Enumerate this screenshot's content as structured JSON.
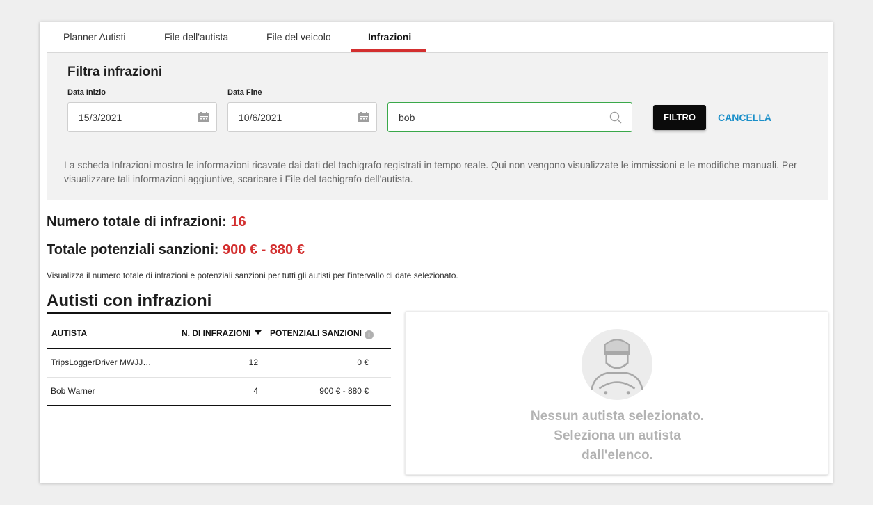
{
  "tabs": [
    {
      "label": "Planner Autisti"
    },
    {
      "label": "File dell'autista"
    },
    {
      "label": "File del veicolo"
    },
    {
      "label": "Infrazioni",
      "active": true
    }
  ],
  "filter": {
    "title": "Filtra infrazioni",
    "start_label": "Data Inizio",
    "start_value": "15/3/2021",
    "end_label": "Data Fine",
    "end_value": "10/6/2021",
    "search_value": "bob",
    "filter_button": "FILTRO",
    "cancel_button": "CANCELLA",
    "info_text": "La scheda Infrazioni mostra le informazioni ricavate dai dati del tachigrafo registrati in tempo reale. Qui non vengono visualizzate le immissioni e le modifiche manuali. Per visualizzare tali informazioni aggiuntive, scaricare i File del tachigrafo dell'autista."
  },
  "totals": {
    "infractions_label": "Numero totale di infrazioni:",
    "infractions_value": "16",
    "sanctions_label": "Totale potenziali sanzioni:",
    "sanctions_value": "900 € - 880 €",
    "note": "Visualizza il numero totale di infrazioni e potenziali sanzioni per tutti gli autisti per l'intervallo di date selezionato."
  },
  "drivers_table": {
    "title": "Autisti con infrazioni",
    "headers": {
      "driver": "AUTISTA",
      "count": "N. DI INFRAZIONI",
      "sanctions": "POTENZIALI SANZIONI"
    },
    "info_icon": "i",
    "rows": [
      {
        "driver": "TripsLoggerDriver MWJJ…",
        "count": "12",
        "sanctions": "0 €"
      },
      {
        "driver": "Bob Warner",
        "count": "4",
        "sanctions": "900 € - 880 €"
      }
    ]
  },
  "empty_state": {
    "line1": "Nessun autista selezionato.",
    "line2": "Seleziona un autista",
    "line3": "dall'elenco."
  },
  "colors": {
    "accent": "#d32f2f",
    "link": "#1a8fc9",
    "search_border": "#3aa84a"
  }
}
